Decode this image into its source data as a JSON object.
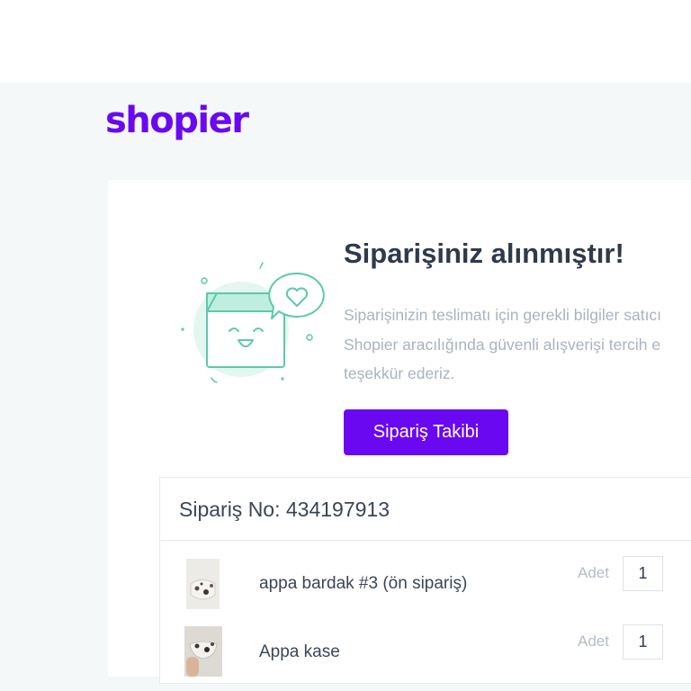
{
  "brand": {
    "logo_text": "shopier",
    "accent_color": "#6a08f2"
  },
  "confirmation": {
    "illustration_icon": "happy-box-with-heart-icon",
    "title": "Siparişiniz alınmıştır!",
    "description_lines": [
      "Siparişinizin teslimatı için gerekli bilgiler satıcı",
      "Shopier aracılığında güvenli alışverişi tercih e",
      "teşekkür ederiz."
    ],
    "track_button_label": "Sipariş Takibi"
  },
  "order": {
    "order_no_label": "Sipariş No: 434197913",
    "items": [
      {
        "name": "appa bardak #3 (ön sipariş)",
        "qty_label": "Adet",
        "qty": "1",
        "thumb_icon": "cup-product-photo"
      },
      {
        "name": "Appa kase",
        "qty_label": "Adet",
        "qty": "1",
        "thumb_icon": "bowl-product-photo"
      }
    ]
  }
}
